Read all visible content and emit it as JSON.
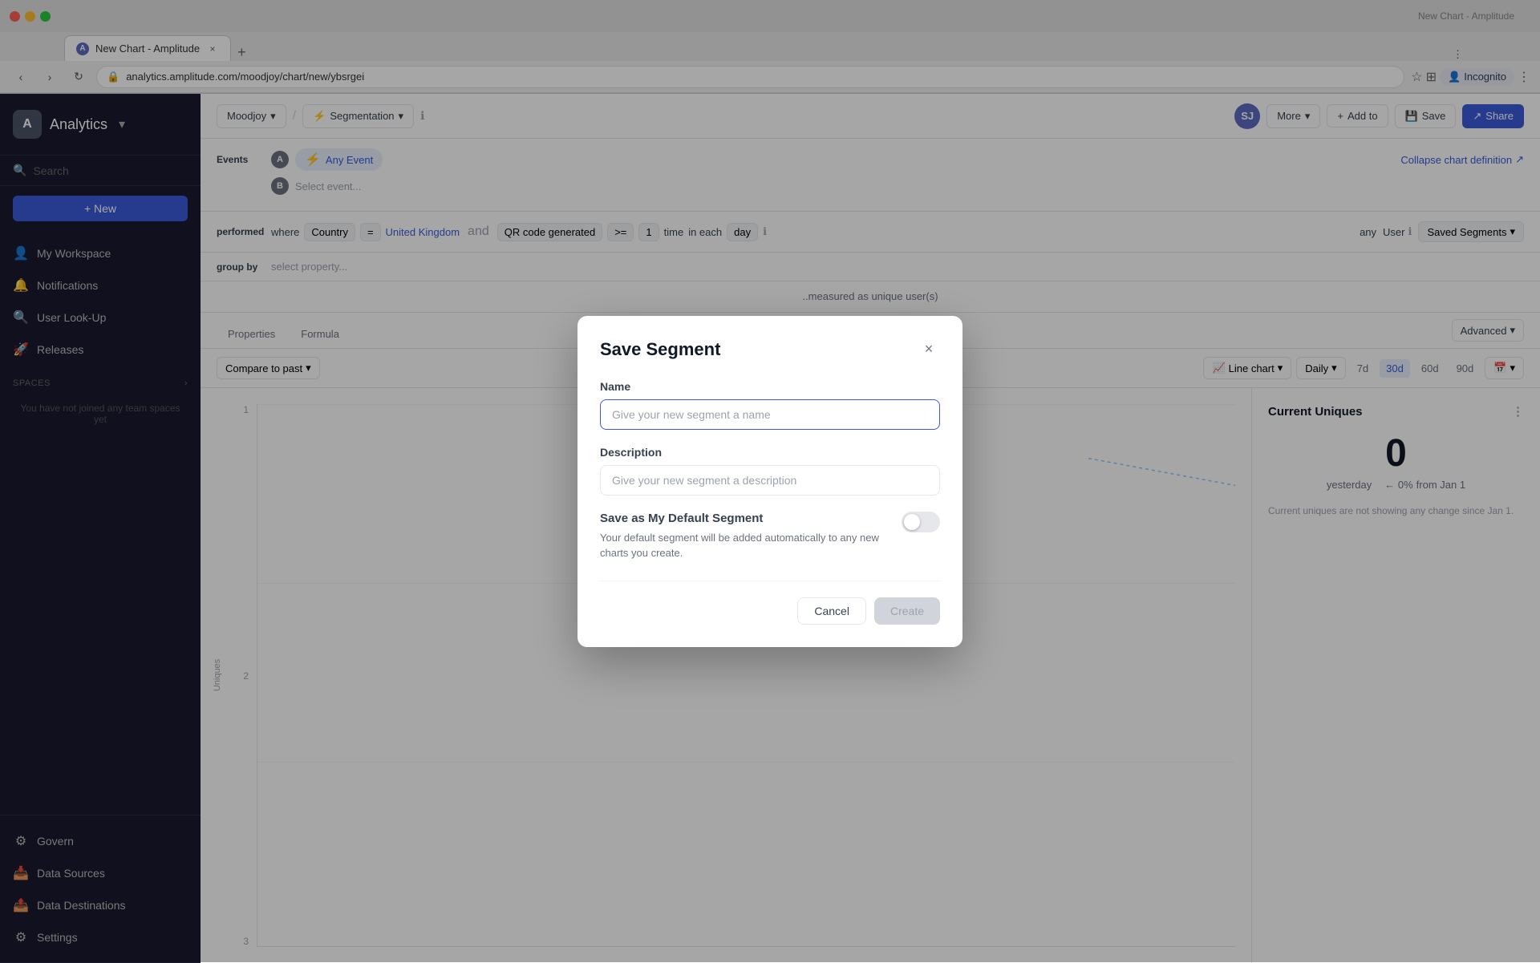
{
  "browser": {
    "tab_title": "New Chart - Amplitude",
    "tab_close": "×",
    "tab_new": "+",
    "address": "analytics.amplitude.com/moodjoy/chart/new/ybsrgei",
    "nav_back": "‹",
    "nav_forward": "›",
    "nav_refresh": "↻",
    "incognito_label": "Incognito",
    "window_controls": {
      "close": "●",
      "minimize": "●",
      "maximize": "●"
    }
  },
  "sidebar": {
    "logo_letter": "A",
    "app_name": "Analytics",
    "app_chevron": "▾",
    "search_placeholder": "Search",
    "new_button": "+ New",
    "nav_items": [
      {
        "id": "my-workspace",
        "icon": "👤",
        "label": "My Workspace"
      },
      {
        "id": "notifications",
        "icon": "🔔",
        "label": "Notifications"
      },
      {
        "id": "user-lookup",
        "icon": "🔍",
        "label": "User Look-Up"
      },
      {
        "id": "releases",
        "icon": "🚀",
        "label": "Releases"
      }
    ],
    "spaces_section": "SPACES",
    "spaces_chevron": "›",
    "spaces_msg": "You have not joined any team spaces yet",
    "bottom_items": [
      {
        "id": "govern",
        "icon": "⚙",
        "label": "Govern"
      },
      {
        "id": "data-sources",
        "icon": "📥",
        "label": "Data Sources"
      },
      {
        "id": "data-destinations",
        "icon": "📤",
        "label": "Data Destinations"
      },
      {
        "id": "settings",
        "icon": "⚙",
        "label": "Settings"
      }
    ]
  },
  "toolbar": {
    "project_name": "Moodjoy",
    "segmentation_label": "Segmentation",
    "info_icon": "ℹ",
    "more_label": "More",
    "add_to_label": "Add to",
    "save_label": "Save",
    "share_label": "Share",
    "avatar_initials": "SJ",
    "collapse_label": "Collapse chart definition"
  },
  "chart_definition": {
    "events_label": "Events",
    "event_badge_a": "A",
    "event_badge_b": "B",
    "event_name": "Any Event",
    "event_icon": "⚡",
    "select_event_placeholder": "Select event...",
    "filters_label": "where",
    "filter_country": "Country",
    "filter_equals": "=",
    "filter_value": "United Kingdom",
    "filter_qr": "QR code generated",
    "filter_gte": ">=",
    "filter_count": "1",
    "filter_time_unit": "time",
    "filter_in_each": "in each",
    "filter_day": "day",
    "info_icon2": "ℹ",
    "groupby_label": "group by",
    "groupby_placeholder": "select property..."
  },
  "segmentation": {
    "performed_label": "performed",
    "any_label": "any",
    "user_label": "User",
    "saved_segments_label": "Saved Segments",
    "dropdown_arrow": "▾"
  },
  "measure_bar": {
    "measured_as": "..measured as unique user(s)"
  },
  "tabs": {
    "items": [
      {
        "id": "properties",
        "label": "Properties"
      },
      {
        "id": "formula",
        "label": "Formula"
      }
    ],
    "advanced_label": "Advanced",
    "advanced_arrow": "▾"
  },
  "chart_controls": {
    "compare_label": "Compare to past",
    "compare_arrow": "▾",
    "chart_type_label": "Line chart",
    "chart_type_arrow": "▾",
    "granularity_label": "Daily",
    "granularity_arrow": "▾",
    "time_options": [
      "7d",
      "30d",
      "60d",
      "90d"
    ],
    "active_time": "30d",
    "calendar_icon": "📅"
  },
  "chart_plot": {
    "y_axis_values": [
      "3",
      "2",
      "1"
    ],
    "y_label": "Uniques"
  },
  "right_panel": {
    "title": "Current Uniques",
    "metric_value": "0",
    "yesterday_label": "yesterday",
    "pct_change": "← 0%",
    "from_label": "from Jan 1",
    "note": "Current uniques are not showing any change since Jan 1.",
    "dots_icon": "⋮"
  },
  "modal": {
    "title": "Save Segment",
    "close_icon": "×",
    "name_label": "Name",
    "name_placeholder": "Give your new segment a name",
    "description_label": "Description",
    "description_placeholder": "Give your new segment a description",
    "default_title": "Save as My Default Segment",
    "default_desc": "Your default segment will be added automatically to any new charts you create.",
    "cancel_label": "Cancel",
    "create_label": "Create"
  }
}
